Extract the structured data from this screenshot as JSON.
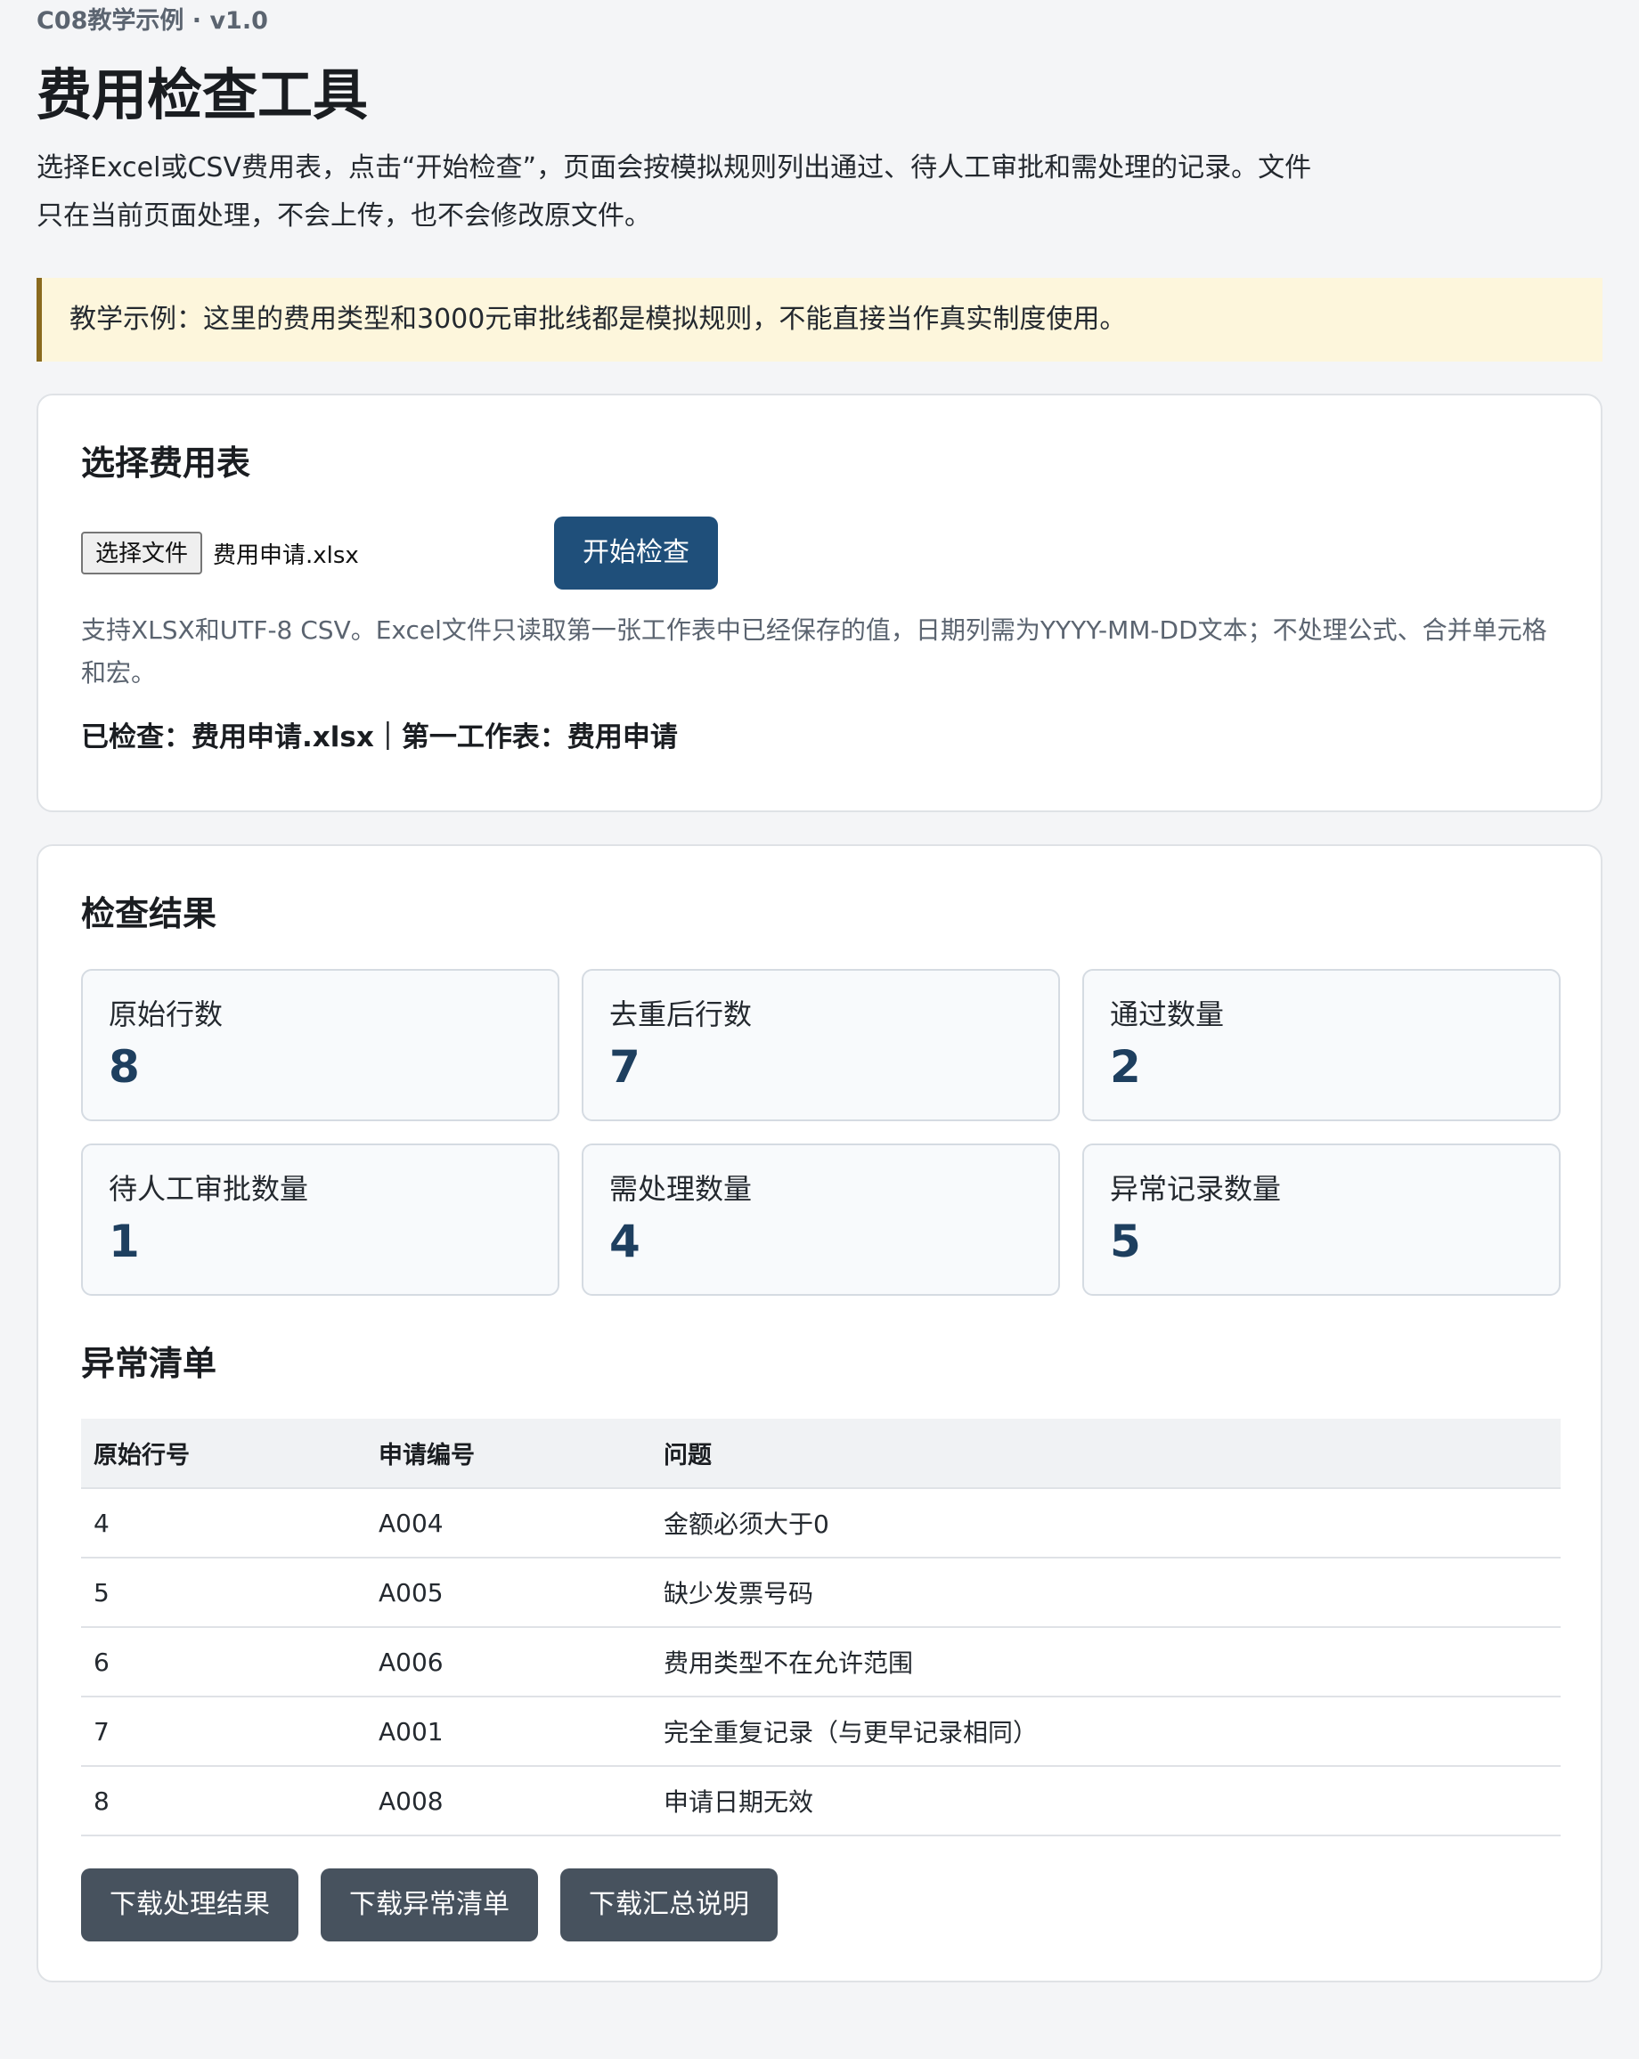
{
  "header": {
    "eyebrow": "C08教学示例 · v1.0",
    "title": "费用检查工具",
    "intro": "选择Excel或CSV费用表，点击“开始检查”，页面会按模拟规则列出通过、待人工审批和需处理的记录。文件只在当前页面处理，不会上传，也不会修改原文件。"
  },
  "notice": "教学示例：这里的费用类型和3000元审批线都是模拟规则，不能直接当作真实制度使用。",
  "select_section": {
    "title": "选择费用表",
    "file_button_label": "选择文件",
    "file_name": "费用申请.xlsx",
    "start_button_label": "开始检查",
    "hint": "支持XLSX和UTF-8 CSV。Excel文件只读取第一张工作表中已经保存的值，日期列需为YYYY-MM-DD文本；不处理公式、合并单元格和宏。",
    "checked_status": "已检查：费用申请.xlsx｜第一工作表：费用申请"
  },
  "results": {
    "title": "检查结果",
    "stats": [
      {
        "label": "原始行数",
        "value": "8"
      },
      {
        "label": "去重后行数",
        "value": "7"
      },
      {
        "label": "通过数量",
        "value": "2"
      },
      {
        "label": "待人工审批数量",
        "value": "1"
      },
      {
        "label": "需处理数量",
        "value": "4"
      },
      {
        "label": "异常记录数量",
        "value": "5"
      }
    ],
    "anomaly_title": "异常清单",
    "table": {
      "headers": [
        "原始行号",
        "申请编号",
        "问题"
      ],
      "rows": [
        [
          "4",
          "A004",
          "金额必须大于0"
        ],
        [
          "5",
          "A005",
          "缺少发票号码"
        ],
        [
          "6",
          "A006",
          "费用类型不在允许范围"
        ],
        [
          "7",
          "A001",
          "完全重复记录（与更早记录相同）"
        ],
        [
          "8",
          "A008",
          "申请日期无效"
        ]
      ]
    },
    "download_buttons": [
      "下载处理结果",
      "下载异常清单",
      "下载汇总说明"
    ]
  }
}
